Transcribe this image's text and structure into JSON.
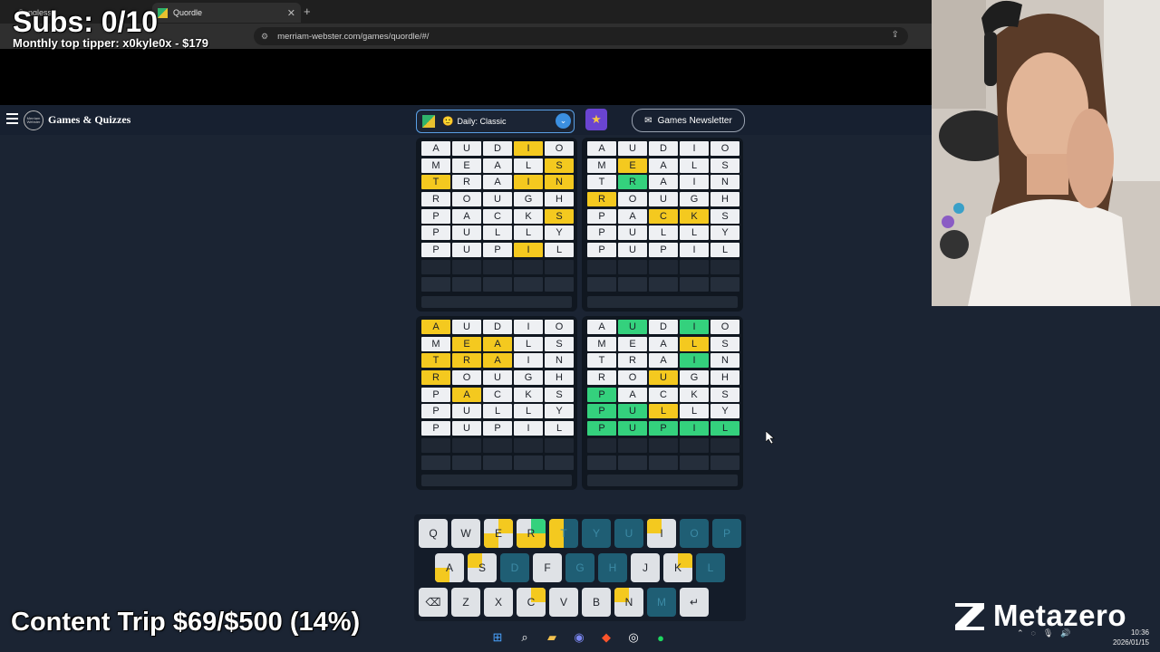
{
  "browser": {
    "tabs": [
      {
        "label": "Songless"
      },
      {
        "label": "Quordle"
      }
    ],
    "url": "merriam-webster.com/games/quordle/#/"
  },
  "site": {
    "brand": "Games & Quizzes",
    "logo_text": "Merriam Webster",
    "mode": "Daily: Classic",
    "newsletter": "Games Newsletter"
  },
  "boards": [
    {
      "rows": [
        [
          [
            "A",
            ""
          ],
          [
            "U",
            ""
          ],
          [
            "D",
            ""
          ],
          [
            "I",
            "y"
          ],
          [
            "O",
            ""
          ]
        ],
        [
          [
            "M",
            ""
          ],
          [
            "E",
            ""
          ],
          [
            "A",
            ""
          ],
          [
            "L",
            ""
          ],
          [
            "S",
            "y"
          ]
        ],
        [
          [
            "T",
            "y"
          ],
          [
            "R",
            ""
          ],
          [
            "A",
            ""
          ],
          [
            "I",
            "y"
          ],
          [
            "N",
            "y"
          ]
        ],
        [
          [
            "R",
            ""
          ],
          [
            "O",
            ""
          ],
          [
            "U",
            ""
          ],
          [
            "G",
            ""
          ],
          [
            "H",
            ""
          ]
        ],
        [
          [
            "P",
            ""
          ],
          [
            "A",
            ""
          ],
          [
            "C",
            ""
          ],
          [
            "K",
            ""
          ],
          [
            "S",
            "y"
          ]
        ],
        [
          [
            "P",
            ""
          ],
          [
            "U",
            ""
          ],
          [
            "L",
            ""
          ],
          [
            "L",
            ""
          ],
          [
            "Y",
            ""
          ]
        ],
        [
          [
            "P",
            ""
          ],
          [
            "U",
            ""
          ],
          [
            "P",
            ""
          ],
          [
            "I",
            "y"
          ],
          [
            "L",
            ""
          ]
        ]
      ]
    },
    {
      "rows": [
        [
          [
            "A",
            ""
          ],
          [
            "U",
            ""
          ],
          [
            "D",
            ""
          ],
          [
            "I",
            ""
          ],
          [
            "O",
            ""
          ]
        ],
        [
          [
            "M",
            ""
          ],
          [
            "E",
            "y"
          ],
          [
            "A",
            ""
          ],
          [
            "L",
            ""
          ],
          [
            "S",
            ""
          ]
        ],
        [
          [
            "T",
            ""
          ],
          [
            "R",
            "g"
          ],
          [
            "A",
            ""
          ],
          [
            "I",
            ""
          ],
          [
            "N",
            ""
          ]
        ],
        [
          [
            "R",
            "y"
          ],
          [
            "O",
            ""
          ],
          [
            "U",
            ""
          ],
          [
            "G",
            ""
          ],
          [
            "H",
            ""
          ]
        ],
        [
          [
            "P",
            ""
          ],
          [
            "A",
            ""
          ],
          [
            "C",
            "y"
          ],
          [
            "K",
            "y"
          ],
          [
            "S",
            ""
          ]
        ],
        [
          [
            "P",
            ""
          ],
          [
            "U",
            ""
          ],
          [
            "L",
            ""
          ],
          [
            "L",
            ""
          ],
          [
            "Y",
            ""
          ]
        ],
        [
          [
            "P",
            ""
          ],
          [
            "U",
            ""
          ],
          [
            "P",
            ""
          ],
          [
            "I",
            ""
          ],
          [
            "L",
            ""
          ]
        ]
      ]
    },
    {
      "rows": [
        [
          [
            "A",
            "y"
          ],
          [
            "U",
            ""
          ],
          [
            "D",
            ""
          ],
          [
            "I",
            ""
          ],
          [
            "O",
            ""
          ]
        ],
        [
          [
            "M",
            ""
          ],
          [
            "E",
            "y"
          ],
          [
            "A",
            "y"
          ],
          [
            "L",
            ""
          ],
          [
            "S",
            ""
          ]
        ],
        [
          [
            "T",
            "y"
          ],
          [
            "R",
            "y"
          ],
          [
            "A",
            "y"
          ],
          [
            "I",
            ""
          ],
          [
            "N",
            ""
          ]
        ],
        [
          [
            "R",
            "y"
          ],
          [
            "O",
            ""
          ],
          [
            "U",
            ""
          ],
          [
            "G",
            ""
          ],
          [
            "H",
            ""
          ]
        ],
        [
          [
            "P",
            ""
          ],
          [
            "A",
            "y"
          ],
          [
            "C",
            ""
          ],
          [
            "K",
            ""
          ],
          [
            "S",
            ""
          ]
        ],
        [
          [
            "P",
            ""
          ],
          [
            "U",
            ""
          ],
          [
            "L",
            ""
          ],
          [
            "L",
            ""
          ],
          [
            "Y",
            ""
          ]
        ],
        [
          [
            "P",
            ""
          ],
          [
            "U",
            ""
          ],
          [
            "P",
            ""
          ],
          [
            "I",
            ""
          ],
          [
            "L",
            ""
          ]
        ]
      ]
    },
    {
      "rows": [
        [
          [
            "A",
            ""
          ],
          [
            "U",
            "g"
          ],
          [
            "D",
            ""
          ],
          [
            "I",
            "g"
          ],
          [
            "O",
            ""
          ]
        ],
        [
          [
            "M",
            ""
          ],
          [
            "E",
            ""
          ],
          [
            "A",
            ""
          ],
          [
            "L",
            "y"
          ],
          [
            "S",
            ""
          ]
        ],
        [
          [
            "T",
            ""
          ],
          [
            "R",
            ""
          ],
          [
            "A",
            ""
          ],
          [
            "I",
            "g"
          ],
          [
            "N",
            ""
          ]
        ],
        [
          [
            "R",
            ""
          ],
          [
            "O",
            ""
          ],
          [
            "U",
            "y"
          ],
          [
            "G",
            ""
          ],
          [
            "H",
            ""
          ]
        ],
        [
          [
            "P",
            "g"
          ],
          [
            "A",
            ""
          ],
          [
            "C",
            ""
          ],
          [
            "K",
            ""
          ],
          [
            "S",
            ""
          ]
        ],
        [
          [
            "P",
            "g"
          ],
          [
            "U",
            "g"
          ],
          [
            "L",
            "y"
          ],
          [
            "L",
            ""
          ],
          [
            "Y",
            ""
          ]
        ],
        [
          [
            "P",
            "g"
          ],
          [
            "U",
            "g"
          ],
          [
            "P",
            "g"
          ],
          [
            "I",
            "g"
          ],
          [
            "L",
            "g"
          ]
        ]
      ]
    }
  ],
  "keyboard": {
    "rows": [
      [
        {
          "label": "Q",
          "q": [
            "",
            "",
            "",
            ""
          ]
        },
        {
          "label": "W",
          "q": [
            "",
            "",
            "",
            ""
          ]
        },
        {
          "label": "E",
          "q": [
            "",
            "y",
            "y",
            ""
          ]
        },
        {
          "label": "R",
          "q": [
            "",
            "g",
            "y",
            "y"
          ]
        },
        {
          "label": "T",
          "q": [
            "y",
            "",
            "y",
            ""
          ],
          "state": "t"
        },
        {
          "label": "Y",
          "q": [
            "",
            "",
            "",
            ""
          ],
          "state": "t"
        },
        {
          "label": "U",
          "q": [
            "",
            "",
            "",
            ""
          ],
          "state": "t"
        },
        {
          "label": "I",
          "q": [
            "y",
            "",
            "",
            ""
          ]
        },
        {
          "label": "O",
          "q": [
            "",
            "",
            "",
            ""
          ],
          "state": "t"
        },
        {
          "label": "P",
          "q": [
            "",
            "",
            "",
            ""
          ],
          "state": "t"
        }
      ],
      [
        {
          "label": "A",
          "q": [
            "",
            "",
            "y",
            ""
          ]
        },
        {
          "label": "S",
          "q": [
            "y",
            "",
            "",
            ""
          ]
        },
        {
          "label": "D",
          "q": [
            "",
            "",
            "",
            ""
          ],
          "state": "t"
        },
        {
          "label": "F",
          "q": [
            "",
            "",
            "",
            ""
          ]
        },
        {
          "label": "G",
          "q": [
            "",
            "",
            "",
            ""
          ],
          "state": "t"
        },
        {
          "label": "H",
          "q": [
            "",
            "",
            "",
            ""
          ],
          "state": "t"
        },
        {
          "label": "J",
          "q": [
            "",
            "",
            "",
            ""
          ]
        },
        {
          "label": "K",
          "q": [
            "",
            "y",
            "",
            ""
          ]
        },
        {
          "label": "L",
          "q": [
            "",
            "",
            "",
            ""
          ],
          "state": "t"
        }
      ],
      [
        {
          "label": "⌫",
          "q": [
            "",
            "",
            "",
            ""
          ]
        },
        {
          "label": "Z",
          "q": [
            "",
            "",
            "",
            ""
          ]
        },
        {
          "label": "X",
          "q": [
            "",
            "",
            "",
            ""
          ]
        },
        {
          "label": "C",
          "q": [
            "",
            "y",
            "",
            ""
          ]
        },
        {
          "label": "V",
          "q": [
            "",
            "",
            "",
            ""
          ]
        },
        {
          "label": "B",
          "q": [
            "",
            "",
            "",
            ""
          ]
        },
        {
          "label": "N",
          "q": [
            "y",
            "",
            "",
            ""
          ]
        },
        {
          "label": "M",
          "q": [
            "",
            "",
            "",
            ""
          ],
          "state": "t"
        },
        {
          "label": "↵",
          "q": [
            "",
            "",
            "",
            ""
          ]
        }
      ]
    ]
  },
  "overlay": {
    "subs": "Subs: 0/10",
    "tipper": "Monthly top tipper: x0kyle0x - $179",
    "content_trip": "Content Trip $69/$500 (14%)",
    "brand": "Metazero"
  },
  "taskbar": {
    "time": "10:36",
    "date": "2026/01/15"
  },
  "colors": {
    "yellow": "#f4c91f",
    "green": "#34d17d",
    "teal": "#1f5e74"
  }
}
